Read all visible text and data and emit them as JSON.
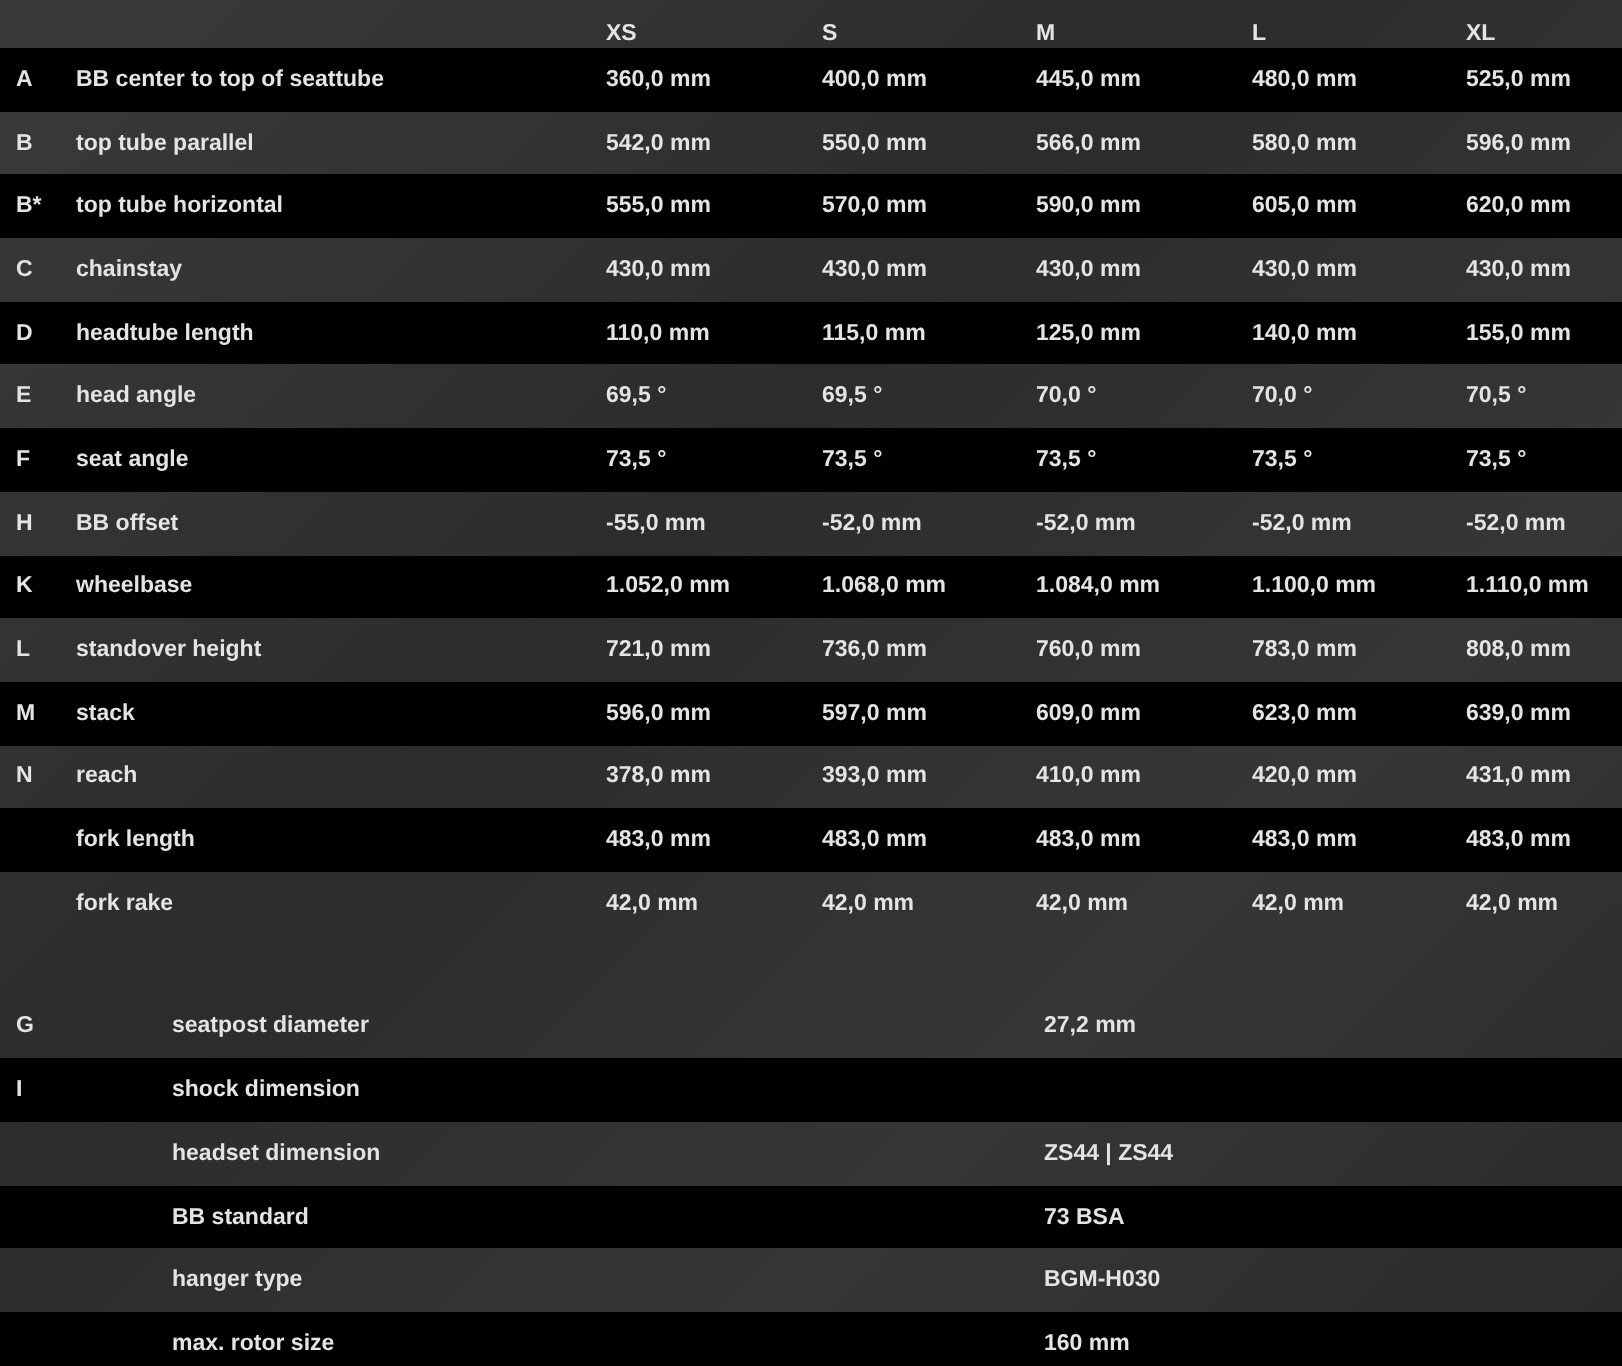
{
  "geometry": {
    "sizes": [
      "XS",
      "S",
      "M",
      "L",
      "XL"
    ],
    "rows": [
      {
        "letter": "A",
        "name": "BB center to top of seattube",
        "values": [
          "360,0 mm",
          "400,0 mm",
          "445,0 mm",
          "480,0 mm",
          "525,0 mm"
        ]
      },
      {
        "letter": "B",
        "name": "top tube parallel",
        "values": [
          "542,0 mm",
          "550,0 mm",
          "566,0 mm",
          "580,0 mm",
          "596,0 mm"
        ]
      },
      {
        "letter": "B*",
        "name": "top tube horizontal",
        "values": [
          "555,0 mm",
          "570,0 mm",
          "590,0 mm",
          "605,0 mm",
          "620,0 mm"
        ]
      },
      {
        "letter": "C",
        "name": "chainstay",
        "values": [
          "430,0 mm",
          "430,0 mm",
          "430,0 mm",
          "430,0 mm",
          "430,0 mm"
        ]
      },
      {
        "letter": "D",
        "name": "headtube length",
        "values": [
          "110,0 mm",
          "115,0 mm",
          "125,0 mm",
          "140,0 mm",
          "155,0 mm"
        ]
      },
      {
        "letter": "E",
        "name": "head angle",
        "values": [
          "69,5 °",
          "69,5 °",
          "70,0 °",
          "70,0 °",
          "70,5 °"
        ]
      },
      {
        "letter": "F",
        "name": "seat angle",
        "values": [
          "73,5 °",
          "73,5 °",
          "73,5 °",
          "73,5 °",
          "73,5 °"
        ]
      },
      {
        "letter": "H",
        "name": "BB offset",
        "values": [
          "-55,0 mm",
          "-52,0 mm",
          "-52,0 mm",
          "-52,0 mm",
          "-52,0 mm"
        ]
      },
      {
        "letter": "K",
        "name": "wheelbase",
        "values": [
          "1.052,0 mm",
          "1.068,0 mm",
          "1.084,0 mm",
          "1.100,0 mm",
          "1.110,0 mm"
        ]
      },
      {
        "letter": "L",
        "name": "standover height",
        "values": [
          "721,0 mm",
          "736,0 mm",
          "760,0 mm",
          "783,0 mm",
          "808,0 mm"
        ]
      },
      {
        "letter": "M",
        "name": "stack",
        "values": [
          "596,0 mm",
          "597,0 mm",
          "609,0 mm",
          "623,0 mm",
          "639,0 mm"
        ]
      },
      {
        "letter": "N",
        "name": "reach",
        "values": [
          "378,0 mm",
          "393,0 mm",
          "410,0 mm",
          "420,0 mm",
          "431,0 mm"
        ]
      },
      {
        "name": "fork length",
        "values": [
          "483,0 mm",
          "483,0 mm",
          "483,0 mm",
          "483,0 mm",
          "483,0 mm"
        ]
      },
      {
        "name": "fork rake",
        "values": [
          "42,0 mm",
          "42,0 mm",
          "42,0 mm",
          "42,0 mm",
          "42,0 mm"
        ]
      }
    ]
  },
  "specs": [
    {
      "letter": "G",
      "name": "seatpost diameter",
      "value": "27,2 mm"
    },
    {
      "letter": "I",
      "name": "shock dimension"
    },
    {
      "name": "headset dimension",
      "value": "ZS44 | ZS44"
    },
    {
      "name": "BB standard",
      "value": "73 BSA"
    },
    {
      "name": "hanger type",
      "value": "BGM-H030"
    },
    {
      "name": "max. rotor size",
      "value": "160 mm"
    }
  ]
}
